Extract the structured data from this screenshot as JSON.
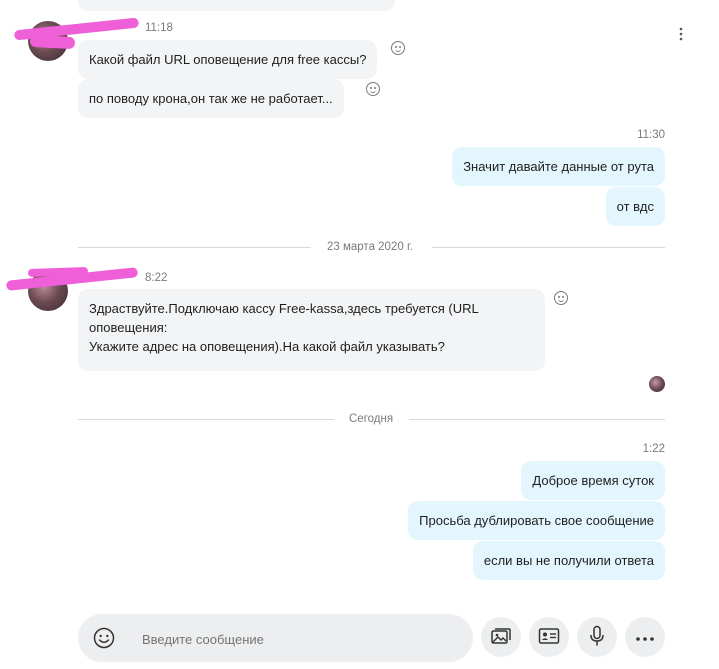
{
  "messages": {
    "group1": {
      "time": "11:18",
      "lines": [
        "Какой файл URL оповещение для free кассы?",
        "по поводу крона,он так же не работает..."
      ]
    },
    "group2": {
      "time": "11:30",
      "lines": [
        "Значит давайте данные от рута",
        "от вдс"
      ]
    },
    "date_divider_1": "23 марта 2020 г.",
    "group3": {
      "time": "8:22",
      "lines": [
        "Здраствуйте.Подключаю кассу Free-kassa,здесь требуется (URL",
        "оповещения:",
        "Укажите адрес на оповещения).На какой файл указывать?"
      ]
    },
    "date_divider_2": "Сегодня",
    "group4": {
      "time": "1:22",
      "lines": [
        "Доброе время суток",
        "Просьба дублировать свое сообщение",
        "если вы не получили ответа"
      ]
    }
  },
  "composer": {
    "placeholder": "Введите сообщение",
    "icons": [
      "emoji-icon",
      "gallery-icon",
      "contact-card-icon",
      "microphone-icon",
      "more-icon"
    ]
  },
  "header": {
    "menu_icon": "kebab-menu-icon"
  },
  "colors": {
    "incoming_bubble": "#f2f4f6",
    "outgoing_bubble": "#e3f6fd",
    "redaction": "#ee5fd8"
  }
}
